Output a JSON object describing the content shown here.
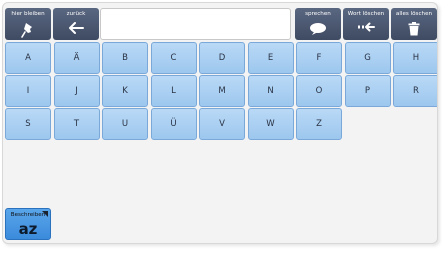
{
  "toolbar": {
    "stay_label": "hier bleiben",
    "back_label": "zurück",
    "speak_label": "sprechen",
    "delete_word_label": "Wort löschen",
    "delete_all_label": "alles löschen"
  },
  "text_field": {
    "value": ""
  },
  "keyboard": {
    "row1": [
      "A",
      "Ä",
      "B",
      "C",
      "D",
      "E",
      "F",
      "G",
      "H"
    ],
    "row2": [
      "I",
      "J",
      "K",
      "L",
      "M",
      "N",
      "O",
      "P",
      "R"
    ],
    "row3": [
      "S",
      "T",
      "U",
      "Ü",
      "V",
      "W",
      "Z"
    ]
  },
  "describe_button": {
    "label": "Beschreiben",
    "glyph": "az"
  },
  "colors": {
    "toolbar": "#4c5872",
    "key": "#a9d0f2",
    "accent": "#3b8bdc"
  }
}
